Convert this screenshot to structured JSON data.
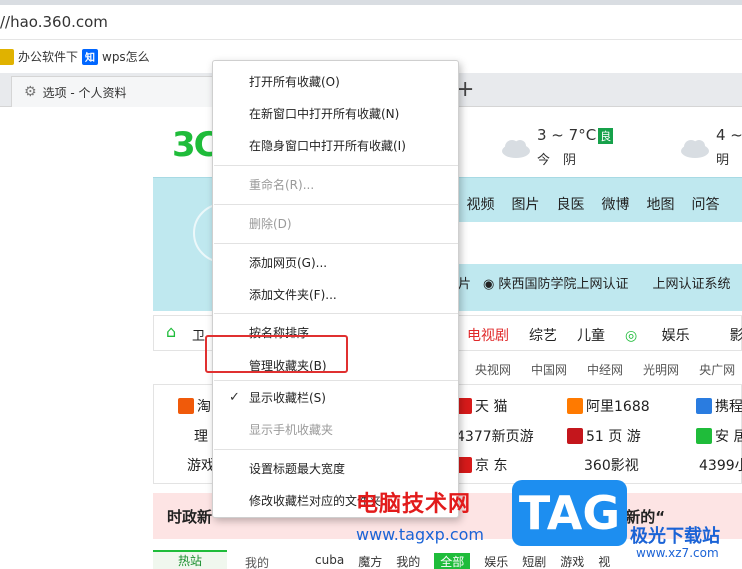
{
  "browser": {
    "url": "//hao.360.com",
    "bookmarks": [
      {
        "label": "办公软件下",
        "icon": "folder-icon",
        "color": "#e0b200"
      },
      {
        "label": "wps怎么",
        "icon": "zhihu-icon",
        "color": "#0066ff",
        "badge": "知"
      }
    ],
    "tab": {
      "label": "选项 - 个人资料",
      "icon": "gear-icon"
    },
    "new_tab": "+"
  },
  "page": {
    "logo": "3C",
    "weather": [
      {
        "temp": "3 ~ 7°C",
        "aq": "良",
        "day": "今　阴"
      },
      {
        "temp": "4 ~",
        "aq": "",
        "day": "明"
      }
    ],
    "search_tabs": [
      "视频",
      "图片",
      "良医",
      "微博",
      "地图",
      "问答"
    ],
    "hotline": [
      "片",
      "陕西国防学院上网认证",
      "上网认证系统"
    ],
    "nav_home": "卫",
    "nav_items": [
      {
        "label": "电视剧",
        "red": true
      },
      {
        "label": "综艺",
        "red": false
      },
      {
        "label": "儿童",
        "red": false
      },
      {
        "label": "娱乐",
        "red": false
      },
      {
        "label": "影视",
        "red": false
      }
    ],
    "sub_links": [
      "央视网",
      "中国网",
      "中经网",
      "光明网",
      "央广网"
    ],
    "sites": {
      "col_left": [
        "淘",
        "理",
        "游戏"
      ],
      "col_a": [
        "天 猫",
        "4377新页游",
        "京 东"
      ],
      "col_b": [
        "阿里1688",
        "51 页 游",
        "360影视"
      ],
      "col_c": [
        "携程",
        "安 居",
        "4399小"
      ]
    },
    "news_left": "时政新",
    "news_right": "防范 上海科技创新的“",
    "bottom_tabs": [
      "热站",
      "我的"
    ],
    "bottom_cats": [
      "cuba",
      "魔方",
      "我的",
      "全部",
      "娱乐",
      "短剧",
      "游戏",
      "视"
    ]
  },
  "context_menu": {
    "items": [
      {
        "label": "打开所有收藏(O)",
        "disabled": false,
        "checked": false
      },
      {
        "label": "在新窗口中打开所有收藏(N)",
        "disabled": false,
        "checked": false
      },
      {
        "label": "在隐身窗口中打开所有收藏(I)",
        "disabled": false,
        "checked": false
      },
      {
        "label": "重命名(R)...",
        "disabled": true,
        "checked": false
      },
      {
        "label": "删除(D)",
        "disabled": true,
        "checked": false
      },
      {
        "label": "添加网页(G)...",
        "disabled": false,
        "checked": false
      },
      {
        "label": "添加文件夹(F)...",
        "disabled": false,
        "checked": false
      },
      {
        "label": "按名称排序",
        "disabled": false,
        "checked": false
      },
      {
        "label": "管理收藏夹(B)",
        "disabled": false,
        "checked": false
      },
      {
        "label": "显示收藏栏(S)",
        "disabled": false,
        "checked": true
      },
      {
        "label": "显示手机收藏夹",
        "disabled": true,
        "checked": false
      },
      {
        "label": "设置标题最大宽度",
        "disabled": false,
        "checked": false
      },
      {
        "label": "修改收藏栏对应的文件夹",
        "disabled": false,
        "checked": false
      }
    ],
    "check_glyph": "✓"
  },
  "watermark": {
    "cn": "电脑技术网",
    "url": "www.tagxp.com",
    "tag": "TAG",
    "site_cn": "极光下载站",
    "site_url": "www.xz7.com"
  },
  "colors": {
    "accent_green": "#1fbc3a",
    "highlight_red": "#e03030",
    "search_bg": "#bfe8ef",
    "watermark_blue": "#1b63d6"
  }
}
